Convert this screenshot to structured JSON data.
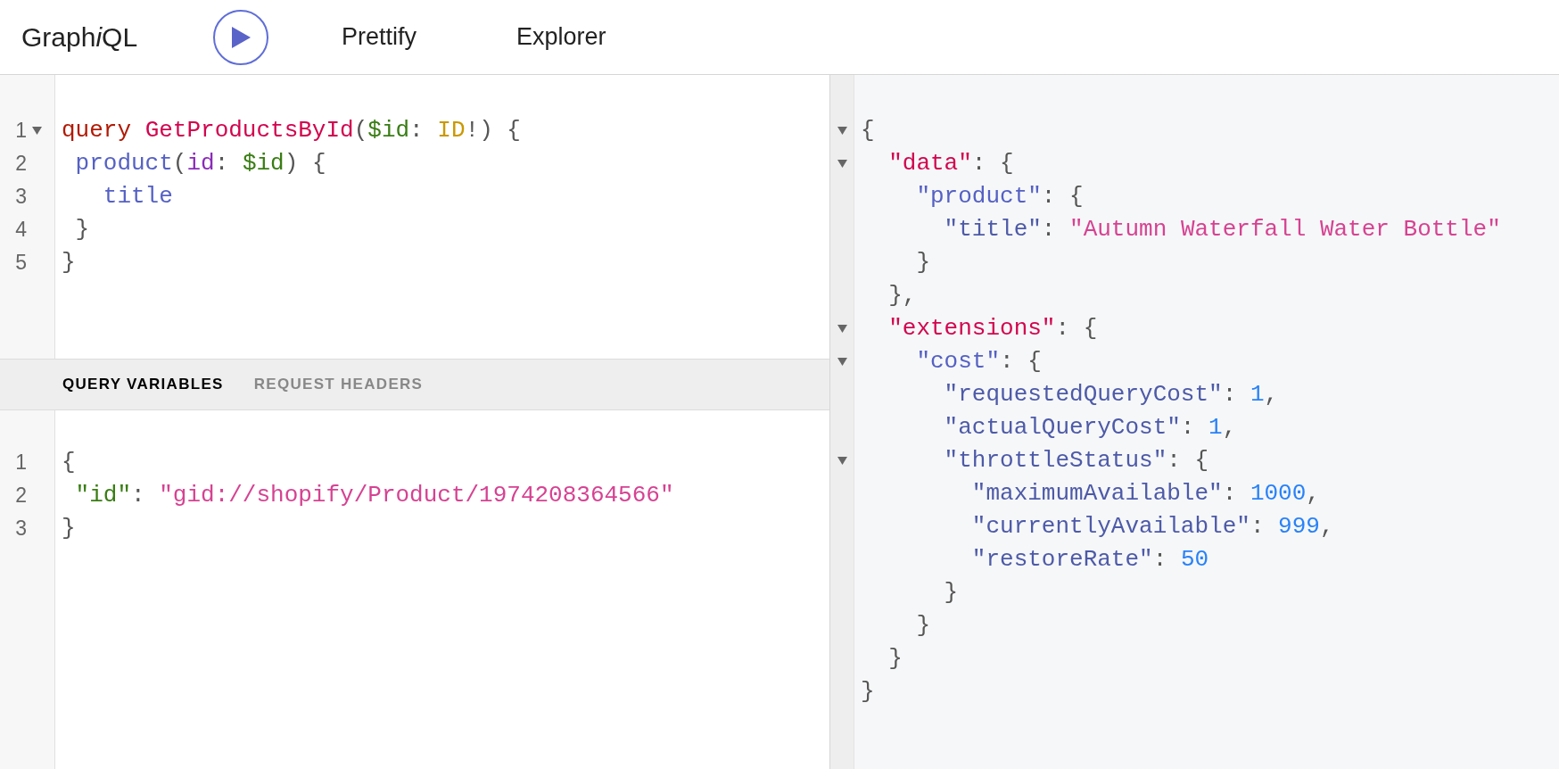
{
  "toolbar": {
    "logo": {
      "before": "Graph",
      "italic": "i",
      "after": "QL"
    },
    "buttons": [
      {
        "label": "Prettify"
      },
      {
        "label": "Explorer"
      }
    ]
  },
  "query_editor": {
    "lines": [
      {
        "number": "1",
        "foldable": true,
        "tokens": [
          {
            "text": "query ",
            "kind": "keyword"
          },
          {
            "text": "GetProductsById",
            "kind": "def"
          },
          {
            "text": "(",
            "kind": "punct"
          },
          {
            "text": "$id",
            "kind": "variable"
          },
          {
            "text": ": ",
            "kind": "punct"
          },
          {
            "text": "ID",
            "kind": "type"
          },
          {
            "text": "!) {",
            "kind": "punct"
          }
        ]
      },
      {
        "number": "2",
        "foldable": false,
        "tokens": [
          {
            "text": " product",
            "kind": "field"
          },
          {
            "text": "(",
            "kind": "punct"
          },
          {
            "text": "id",
            "kind": "attribute"
          },
          {
            "text": ": ",
            "kind": "punct"
          },
          {
            "text": "$id",
            "kind": "variable"
          },
          {
            "text": ") {",
            "kind": "punct"
          }
        ]
      },
      {
        "number": "3",
        "foldable": false,
        "tokens": [
          {
            "text": "   title",
            "kind": "field"
          }
        ]
      },
      {
        "number": "4",
        "foldable": false,
        "tokens": [
          {
            "text": " }",
            "kind": "punct"
          }
        ]
      },
      {
        "number": "5",
        "foldable": false,
        "tokens": [
          {
            "text": "}",
            "kind": "punct"
          }
        ]
      }
    ]
  },
  "variables_tabs": [
    {
      "label": "QUERY VARIABLES",
      "selected": true
    },
    {
      "label": "REQUEST HEADERS",
      "selected": false
    }
  ],
  "variables_editor": {
    "lines": [
      {
        "number": "1",
        "foldable": false,
        "tokens": [
          {
            "text": "{",
            "kind": "punct"
          }
        ]
      },
      {
        "number": "2",
        "foldable": false,
        "tokens": [
          {
            "text": " \"id\"",
            "kind": "variable"
          },
          {
            "text": ": ",
            "kind": "punct"
          },
          {
            "text": "\"gid://shopify/Product/1974208364566\"",
            "kind": "string"
          }
        ]
      },
      {
        "number": "3",
        "foldable": false,
        "tokens": [
          {
            "text": "}",
            "kind": "punct"
          }
        ]
      }
    ]
  },
  "result": {
    "lines": [
      {
        "foldable": true,
        "tokens": [
          {
            "text": "{",
            "kind": "punct"
          }
        ]
      },
      {
        "foldable": true,
        "tokens": [
          {
            "text": "  \"data\"",
            "kind": "def"
          },
          {
            "text": ": {",
            "kind": "punct"
          }
        ]
      },
      {
        "foldable": false,
        "tokens": [
          {
            "text": "    \"product\"",
            "kind": "field"
          },
          {
            "text": ": {",
            "kind": "punct"
          }
        ]
      },
      {
        "foldable": false,
        "tokens": [
          {
            "text": "      \"title\"",
            "kind": "key"
          },
          {
            "text": ": ",
            "kind": "punct"
          },
          {
            "text": "\"Autumn Waterfall Water Bottle\"",
            "kind": "string"
          }
        ]
      },
      {
        "foldable": false,
        "tokens": [
          {
            "text": "    }",
            "kind": "punct"
          }
        ]
      },
      {
        "foldable": false,
        "tokens": [
          {
            "text": "  },",
            "kind": "punct"
          }
        ]
      },
      {
        "foldable": true,
        "tokens": [
          {
            "text": "  \"extensions\"",
            "kind": "def"
          },
          {
            "text": ": {",
            "kind": "punct"
          }
        ]
      },
      {
        "foldable": true,
        "tokens": [
          {
            "text": "    \"cost\"",
            "kind": "field"
          },
          {
            "text": ": {",
            "kind": "punct"
          }
        ]
      },
      {
        "foldable": false,
        "tokens": [
          {
            "text": "      \"requestedQueryCost\"",
            "kind": "key"
          },
          {
            "text": ": ",
            "kind": "punct"
          },
          {
            "text": "1",
            "kind": "number"
          },
          {
            "text": ",",
            "kind": "punct"
          }
        ]
      },
      {
        "foldable": false,
        "tokens": [
          {
            "text": "      \"actualQueryCost\"",
            "kind": "key"
          },
          {
            "text": ": ",
            "kind": "punct"
          },
          {
            "text": "1",
            "kind": "number"
          },
          {
            "text": ",",
            "kind": "punct"
          }
        ]
      },
      {
        "foldable": true,
        "tokens": [
          {
            "text": "      \"throttleStatus\"",
            "kind": "key"
          },
          {
            "text": ": {",
            "kind": "punct"
          }
        ]
      },
      {
        "foldable": false,
        "tokens": [
          {
            "text": "        \"maximumAvailable\"",
            "kind": "key"
          },
          {
            "text": ": ",
            "kind": "punct"
          },
          {
            "text": "1000",
            "kind": "number"
          },
          {
            "text": ",",
            "kind": "punct"
          }
        ]
      },
      {
        "foldable": false,
        "tokens": [
          {
            "text": "        \"currentlyAvailable\"",
            "kind": "key"
          },
          {
            "text": ": ",
            "kind": "punct"
          },
          {
            "text": "999",
            "kind": "number"
          },
          {
            "text": ",",
            "kind": "punct"
          }
        ]
      },
      {
        "foldable": false,
        "tokens": [
          {
            "text": "        \"restoreRate\"",
            "kind": "key"
          },
          {
            "text": ": ",
            "kind": "punct"
          },
          {
            "text": "50",
            "kind": "number"
          }
        ]
      },
      {
        "foldable": false,
        "tokens": [
          {
            "text": "      }",
            "kind": "punct"
          }
        ]
      },
      {
        "foldable": false,
        "tokens": [
          {
            "text": "    }",
            "kind": "punct"
          }
        ]
      },
      {
        "foldable": false,
        "tokens": [
          {
            "text": "  }",
            "kind": "punct"
          }
        ]
      },
      {
        "foldable": false,
        "tokens": [
          {
            "text": "}",
            "kind": "punct"
          }
        ]
      }
    ]
  }
}
